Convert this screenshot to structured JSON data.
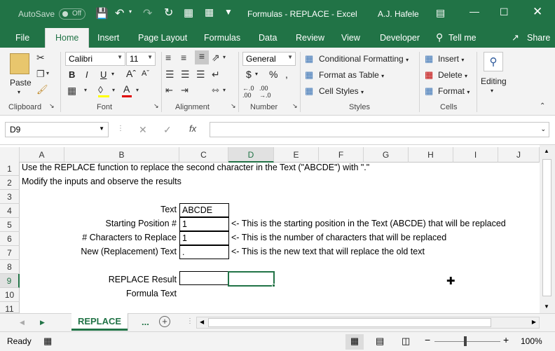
{
  "titlebar": {
    "autosave": "AutoSave",
    "autosave_state": "Off",
    "doc_title": "Formulas - REPLACE  -  Excel",
    "user": "A.J. Hafele"
  },
  "tabs": [
    "File",
    "Home",
    "Insert",
    "Page Layout",
    "Formulas",
    "Data",
    "Review",
    "Developer"
  ],
  "tellme": "Tell me",
  "share": "Share",
  "ribbon": {
    "clipboard": {
      "paste": "Paste",
      "label": "Clipboard"
    },
    "font": {
      "name": "Calibri",
      "size": "11",
      "bold": "B",
      "italic": "I",
      "underline": "U",
      "label": "Font"
    },
    "alignment": {
      "label": "Alignment"
    },
    "number": {
      "format": "General",
      "label": "Number"
    },
    "styles": {
      "cond": "Conditional Formatting",
      "table": "Format as Table",
      "cell": "Cell Styles",
      "label": "Styles"
    },
    "cells": {
      "insert": "Insert",
      "delete": "Delete",
      "format": "Format",
      "label": "Cells"
    },
    "editing": {
      "label": "Editing"
    }
  },
  "formula_bar": {
    "name_box": "D9",
    "value": ""
  },
  "columns": [
    "A",
    "B",
    "C",
    "D",
    "E",
    "F",
    "G",
    "H",
    "I",
    "J"
  ],
  "rows": [
    "1",
    "2",
    "3",
    "4",
    "5",
    "6",
    "7",
    "8",
    "9",
    "10",
    "11"
  ],
  "cells": {
    "a1": "Use the REPLACE function to replace the second character in the Text (\"ABCDE\") with \".\"",
    "a2": "Modify the inputs and observe the results",
    "b4": "Text",
    "c4": "ABCDE",
    "b5": "Starting Position #",
    "c5": "1",
    "d5": "<- This is the starting position in the Text (ABCDE) that will be replaced",
    "b6": "# Characters to Replace",
    "c6": "1",
    "d6": "<- This is the number of characters that will be replaced",
    "b7": "New (Replacement) Text",
    "c7": ".",
    "d7": "<- This is the new text that will replace the old text",
    "b9": "REPLACE Result",
    "b10": "Formula Text"
  },
  "sheet_tab": "REPLACE",
  "sheet_more": "...",
  "status": {
    "mode": "Ready",
    "zoom": "100%"
  }
}
